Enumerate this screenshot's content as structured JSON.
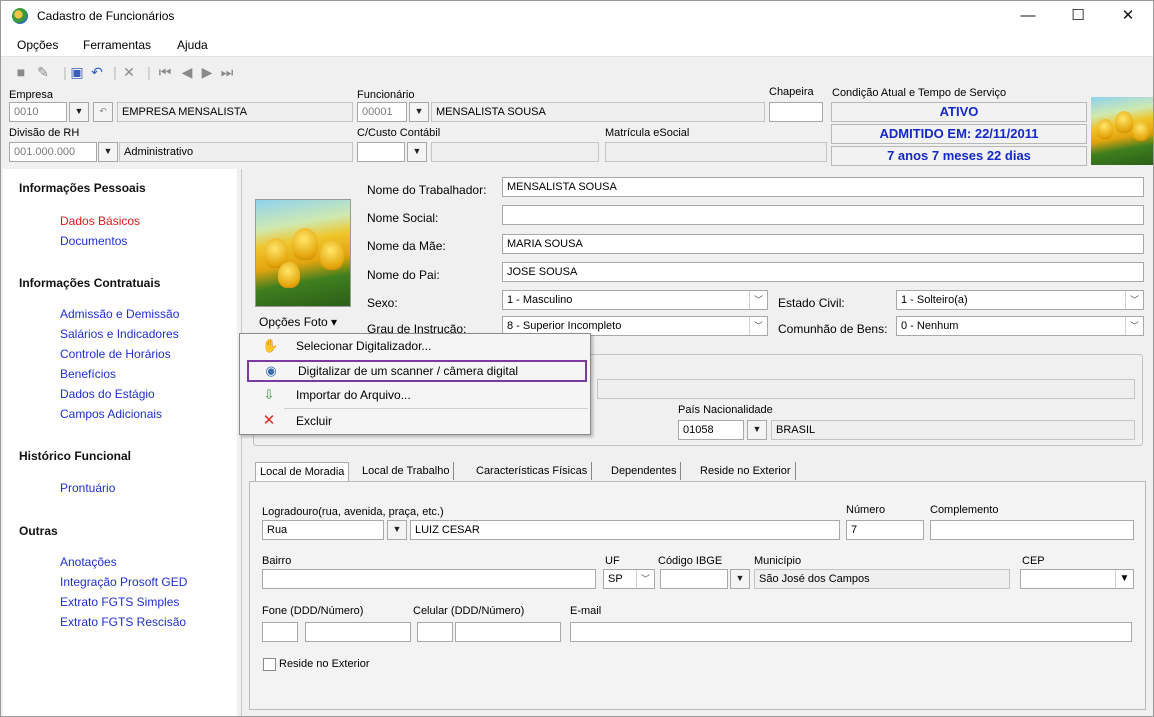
{
  "window": {
    "title": "Cadastro de Funcionários",
    "minimize": "—",
    "maximize": "☐",
    "close": "✕"
  },
  "menubar": {
    "items": [
      "Opções",
      "Ferramentas",
      "Ajuda"
    ]
  },
  "header": {
    "empresa_label": "Empresa",
    "empresa_code": "0010",
    "empresa_name": "EMPRESA MENSALISTA",
    "divisao_label": "Divisão de RH",
    "divisao_code": "001.000.000",
    "divisao_name": "Administrativo",
    "funcionario_label": "Funcionário",
    "funcionario_code": "00001",
    "funcionario_name": "MENSALISTA SOUSA",
    "ccusto_label": "C/Custo Contábil",
    "ccusto_value": "",
    "matricula_label": "Matrícula eSocial",
    "matricula_value": "",
    "chapeira_label": "Chapeira",
    "chapeira_value": "",
    "condicao_label": "Condição Atual e Tempo de Serviço",
    "status": "ATIVO",
    "admitido": "ADMITIDO EM: 22/11/2011",
    "tempo": "7 anos 7 meses 22 dias"
  },
  "nav": {
    "sections": [
      {
        "title": "Informações Pessoais",
        "items": [
          "Dados Básicos",
          "Documentos"
        ]
      },
      {
        "title": "Informações Contratuais",
        "items": [
          "Admissão e Demissão",
          "Salários e Indicadores",
          "Controle de Horários",
          "Benefícios",
          "Dados do Estágio",
          "Campos Adicionais"
        ]
      },
      {
        "title": "Histórico Funcional",
        "items": [
          "Prontuário"
        ]
      },
      {
        "title": "Outras",
        "items": [
          "Anotações",
          "Integração Prosoft GED",
          "Extrato FGTS Simples",
          "Extrato FGTS Rescisão"
        ]
      }
    ],
    "active": "Dados Básicos"
  },
  "form": {
    "nome_trabalhador_label": "Nome do Trabalhador:",
    "nome_trabalhador": "MENSALISTA SOUSA",
    "nome_social_label": "Nome Social:",
    "nome_social": "",
    "nome_mae_label": "Nome da Mãe:",
    "nome_mae": "MARIA SOUSA",
    "nome_pai_label": "Nome do Pai:",
    "nome_pai": "JOSE SOUSA",
    "sexo_label": "Sexo:",
    "sexo": "1 - Masculino",
    "estado_civil_label": "Estado Civil:",
    "estado_civil": "1 - Solteiro(a)",
    "grau_label": "Grau de Instrução:",
    "grau": "8 - Superior Incompleto",
    "comunhao_label": "Comunhão de Bens:",
    "comunhao": "0 - Nenhum",
    "opcoes_foto": "Opções Foto",
    "pais_label": "País Nacionalidade",
    "pais_code": "01058",
    "pais_name": "BRASIL"
  },
  "photo_menu": {
    "items": [
      {
        "label": "Selecionar Digitalizador...",
        "icon": "scanner-icon"
      },
      {
        "label": "Digitalizar de um scanner / câmera digital",
        "icon": "camera-icon"
      },
      {
        "label": "Importar do Arquivo...",
        "icon": "import-icon"
      },
      {
        "label": "Excluir",
        "icon": "delete-icon"
      }
    ],
    "highlight_color": "#7a3aa0"
  },
  "tabs": [
    "Local de Moradia",
    "Local de Trabalho",
    "Características Físicas",
    "Dependentes",
    "Reside no Exterior"
  ],
  "address": {
    "logradouro_label": "Logradouro(rua, avenida, praça, etc.)",
    "tipo": "Rua",
    "logradouro": "LUIZ CESAR",
    "numero_label": "Número",
    "numero": "7",
    "complemento_label": "Complemento",
    "complemento": "",
    "bairro_label": "Bairro",
    "bairro": "",
    "uf_label": "UF",
    "uf": "SP",
    "ibge_label": "Código IBGE",
    "ibge": "",
    "municipio_label": "Município",
    "municipio": "São José dos Campos",
    "cep_label": "CEP",
    "cep": "",
    "fone_label": "Fone (DDD/Número)",
    "celular_label": "Celular (DDD/Número)",
    "email_label": "E-mail",
    "reside_exterior_label": "Reside no Exterior"
  },
  "colors": {
    "link": "#1f2fd0",
    "active_link": "#e01a1a",
    "status_text": "#1328c8"
  }
}
